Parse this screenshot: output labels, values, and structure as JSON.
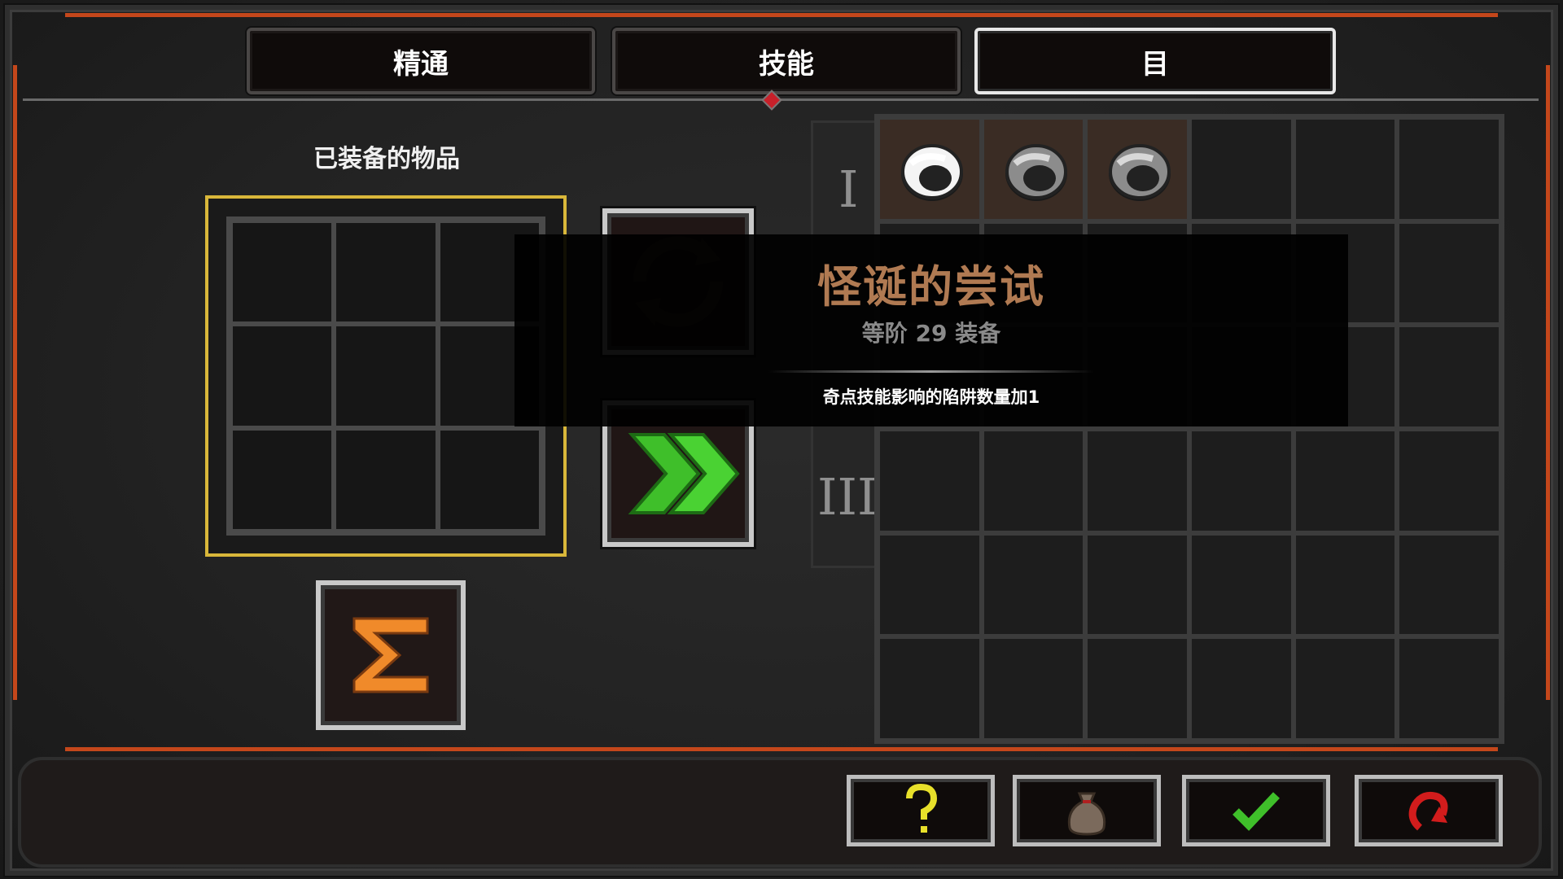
{
  "tabs": [
    {
      "label": "精通",
      "active": false
    },
    {
      "label": "技能",
      "active": false
    },
    {
      "label": "目",
      "active": true
    }
  ],
  "equipped": {
    "title": "已装备的物品",
    "rows": 3,
    "cols": 3
  },
  "actions": {
    "refresh_icon": "refresh-arrows-icon",
    "advance_icon": "double-chevron-right-icon",
    "sum_icon": "sigma-icon"
  },
  "tiers": [
    "I",
    "III"
  ],
  "inventory": {
    "rows": 6,
    "cols": 6,
    "items": [
      {
        "row": 0,
        "col": 0,
        "icon": "ring-white-icon"
      },
      {
        "row": 0,
        "col": 1,
        "icon": "ring-silver-icon"
      },
      {
        "row": 0,
        "col": 2,
        "icon": "ring-silver-icon"
      }
    ]
  },
  "tooltip": {
    "name": "怪诞的尝试",
    "subtitle": "等阶 29 装备",
    "description": "奇点技能影响的陷阱数量加1"
  },
  "bottom_buttons": [
    {
      "name": "help-button",
      "icon": "question-icon"
    },
    {
      "name": "loot-bag-button",
      "icon": "bag-icon"
    },
    {
      "name": "confirm-button",
      "icon": "checkmark-icon"
    },
    {
      "name": "undo-button",
      "icon": "undo-arrow-icon"
    }
  ],
  "colors": {
    "accent_orange": "#c4471b",
    "equip_border": "#d9b73a",
    "tooltip_name": "#b07a52",
    "advance_green": "#3fbf2a",
    "sigma_orange": "#f08a2a"
  }
}
